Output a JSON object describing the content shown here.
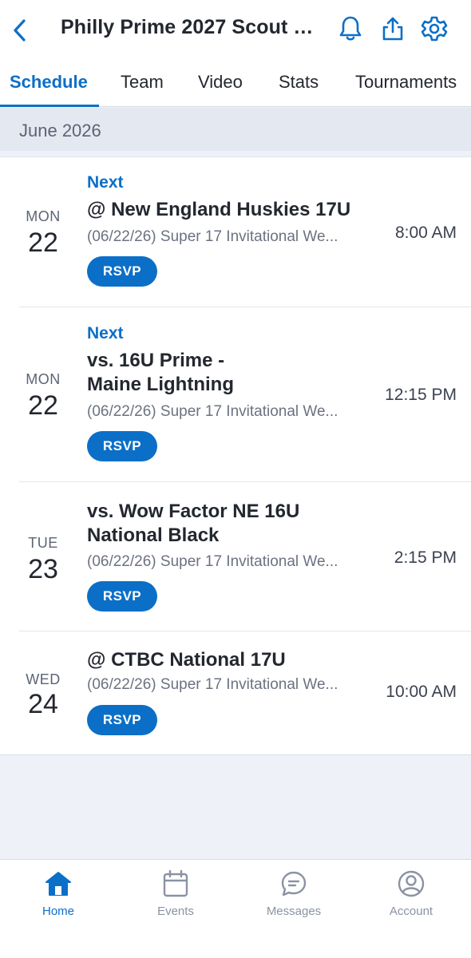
{
  "header": {
    "title": "Philly Prime 2027 Scout 1...",
    "icons": [
      "back-chevron-icon",
      "bell-icon",
      "share-icon",
      "gear-icon"
    ],
    "accent_color": "#0b6fc7"
  },
  "tabs": [
    {
      "label": "Schedule",
      "active": true
    },
    {
      "label": "Team",
      "active": false
    },
    {
      "label": "Video",
      "active": false
    },
    {
      "label": "Stats",
      "active": false
    },
    {
      "label": "Tournaments",
      "active": false
    }
  ],
  "schedule": {
    "month": "June 2026",
    "events": [
      {
        "dow": "MON",
        "day": "22",
        "next": "Next",
        "opponent": "@ New England Huskies 17U",
        "subtitle": "(06/22/26) Super 17 Invitational We...",
        "time": "8:00 AM",
        "rsvp": "RSVP"
      },
      {
        "dow": "MON",
        "day": "22",
        "next": "Next",
        "opponent": "vs. 16U Prime - Maine Lightning",
        "subtitle": "(06/22/26) Super 17 Invitational We...",
        "time": "12:15 PM",
        "rsvp": "RSVP"
      },
      {
        "dow": "TUE",
        "day": "23",
        "next": "",
        "opponent": "vs. Wow Factor NE 16U National Black",
        "subtitle": "(06/22/26) Super 17 Invitational We...",
        "time": "2:15 PM",
        "rsvp": "RSVP"
      },
      {
        "dow": "WED",
        "day": "24",
        "next": "",
        "opponent": "@ CTBC National 17U",
        "subtitle": "(06/22/26) Super 17 Invitational We...",
        "time": "10:00 AM",
        "rsvp": "RSVP"
      }
    ]
  },
  "bottom_nav": [
    {
      "label": "Home",
      "icon": "home-icon",
      "active": true
    },
    {
      "label": "Events",
      "icon": "calendar-icon",
      "active": false
    },
    {
      "label": "Messages",
      "icon": "chat-bubble-icon",
      "active": false
    },
    {
      "label": "Account",
      "icon": "account-icon",
      "active": false
    }
  ]
}
